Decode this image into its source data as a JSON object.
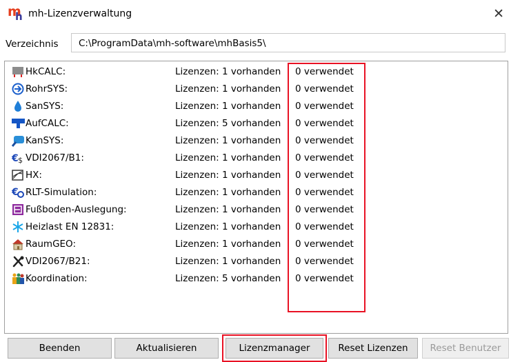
{
  "window": {
    "title": "mh-Lizenzverwaltung",
    "close_symbol": "✕",
    "logo_letters": [
      "m",
      "h"
    ]
  },
  "directory": {
    "label": "Verzeichnis",
    "value": "C:\\ProgramData\\mh-software\\mhBasis5\\"
  },
  "licenses": [
    {
      "name": "HkCALC:",
      "licenses": "Lizenzen: 1 vorhanden",
      "used": "0 verwendet",
      "icon": "hkcalc-radiator-icon"
    },
    {
      "name": "RohrSYS:",
      "licenses": "Lizenzen: 1 vorhanden",
      "used": "0 verwendet",
      "icon": "rohrsys-arrow-icon"
    },
    {
      "name": "SanSYS:",
      "licenses": "Lizenzen: 1 vorhanden",
      "used": "0 verwendet",
      "icon": "sansys-drop-icon"
    },
    {
      "name": "AufCALC:",
      "licenses": "Lizenzen: 5 vorhanden",
      "used": "0 verwendet",
      "icon": "aufcalc-blue-icon"
    },
    {
      "name": "KanSYS:",
      "licenses": "Lizenzen: 1 vorhanden",
      "used": "0 verwendet",
      "icon": "kansys-icon"
    },
    {
      "name": "VDI2067/B1:",
      "licenses": "Lizenzen: 1 vorhanden",
      "used": "0 verwendet",
      "icon": "euro-dollar-icon"
    },
    {
      "name": "HX:",
      "licenses": "Lizenzen: 1 vorhanden",
      "used": "0 verwendet",
      "icon": "hx-chart-icon"
    },
    {
      "name": "RLT-Simulation:",
      "licenses": "Lizenzen: 1 vorhanden",
      "used": "0 verwendet",
      "icon": "rlt-euro-icon"
    },
    {
      "name": "Fußboden-Auslegung:",
      "licenses": "Lizenzen: 1 vorhanden",
      "used": "0 verwendet",
      "icon": "floor-heating-icon"
    },
    {
      "name": "Heizlast EN 12831:",
      "licenses": "Lizenzen: 1 vorhanden",
      "used": "0 verwendet",
      "icon": "snowflake-icon"
    },
    {
      "name": "RaumGEO:",
      "licenses": "Lizenzen: 1 vorhanden",
      "used": "0 verwendet",
      "icon": "house-icon"
    },
    {
      "name": "VDI2067/B21:",
      "licenses": "Lizenzen: 1 vorhanden",
      "used": "0 verwendet",
      "icon": "tools-icon"
    },
    {
      "name": "Koordination:",
      "licenses": "Lizenzen: 5 vorhanden",
      "used": "0 verwendet",
      "icon": "people-icon"
    }
  ],
  "buttons": {
    "beenden": "Beenden",
    "aktualisieren": "Aktualisieren",
    "lizenzmanager": "Lizenzmanager",
    "reset_lizenzen": "Reset Lizenzen",
    "reset_benutzer": "Reset Benutzer"
  },
  "highlight_color": "#e81123"
}
